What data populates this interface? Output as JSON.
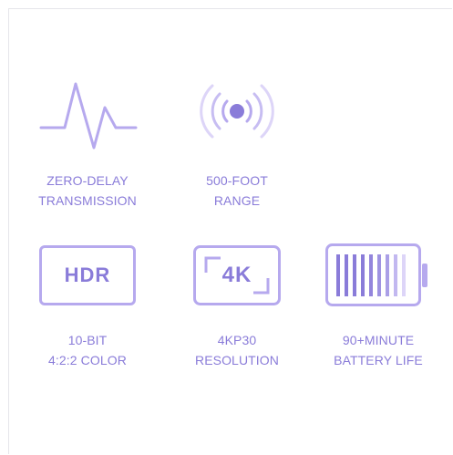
{
  "colors": {
    "accent": "#8a7cd9",
    "accent_light": "#b6a9ee",
    "accent_pale": "#d8cff7",
    "border": "#e6e6ea"
  },
  "features": [
    {
      "icon": "waveform-icon",
      "line1": "ZERO-DELAY",
      "line2": "TRANSMISSION"
    },
    {
      "icon": "signal-broadcast-icon",
      "line1": "500-FOOT",
      "line2": "RANGE"
    },
    {
      "icon": "hdr-icon",
      "badge_text": "HDR",
      "line1": "10-BIT",
      "line2": "4:2:2 COLOR"
    },
    {
      "icon": "4k-icon",
      "badge_text": "4K",
      "line1": "4KP30",
      "line2": "RESOLUTION"
    },
    {
      "icon": "battery-icon",
      "line1": "90+MINUTE",
      "line2": "BATTERY LIFE"
    }
  ]
}
